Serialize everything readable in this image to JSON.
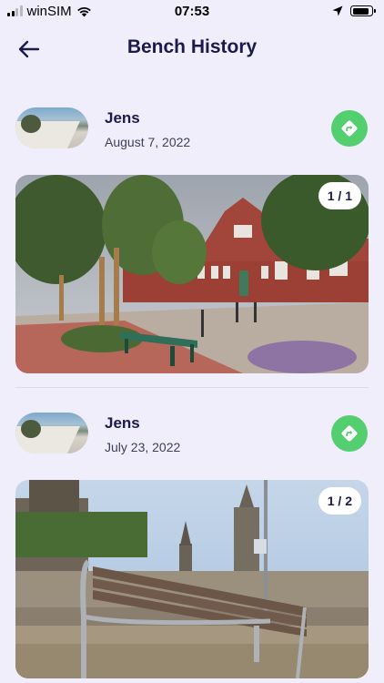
{
  "status_bar": {
    "carrier": "winSIM",
    "time": "07:53"
  },
  "header": {
    "title": "Bench History",
    "back_icon": "arrow-left-icon"
  },
  "entries": [
    {
      "name": "Jens",
      "date": "August 7, 2022",
      "photo_count": "1 / 1",
      "direction_icon": "directions-icon"
    },
    {
      "name": "Jens",
      "date": "July 23, 2022",
      "photo_count": "1 / 2",
      "direction_icon": "directions-icon"
    }
  ],
  "colors": {
    "background": "#efeefa",
    "title": "#1b1a4b",
    "accent_green": "#54cf70"
  }
}
